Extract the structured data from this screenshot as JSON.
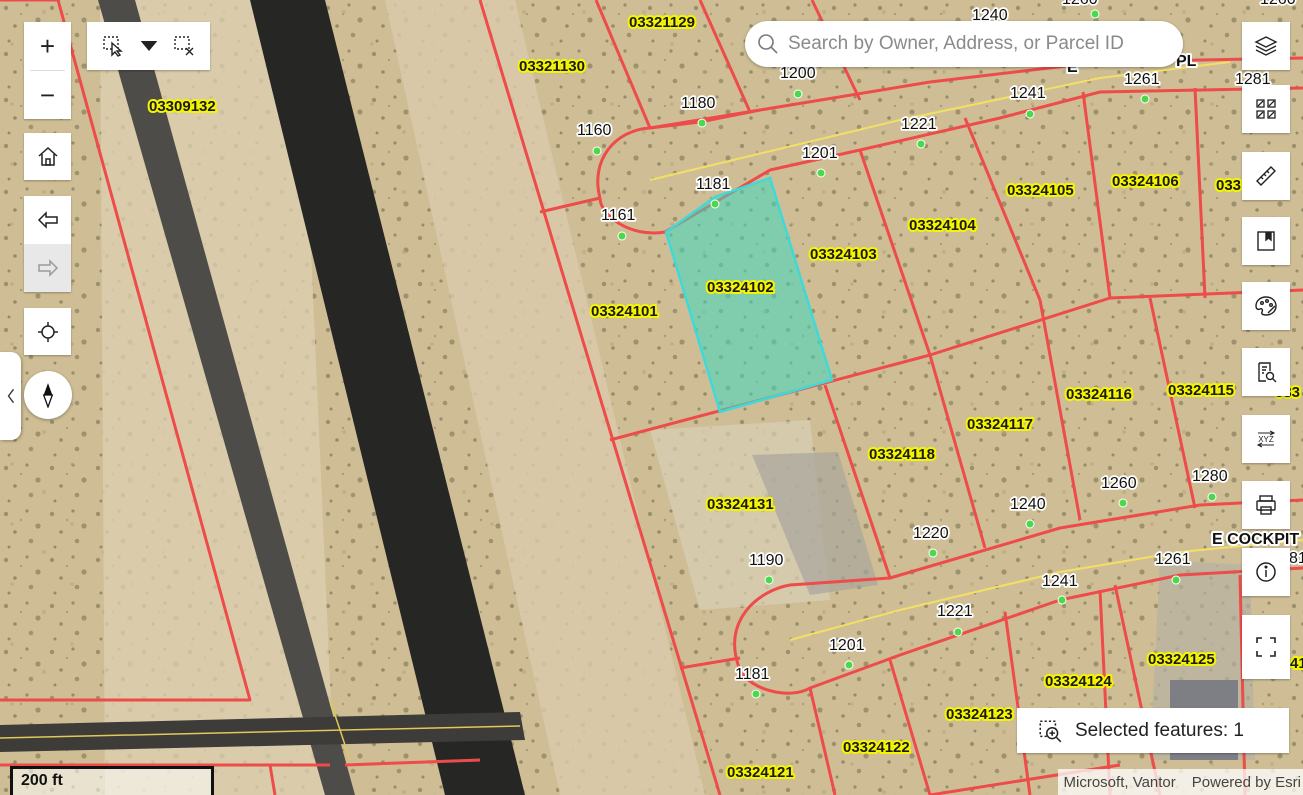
{
  "map": {
    "parcels": [
      {
        "id": "03321129"
      },
      {
        "id": "03321130"
      },
      {
        "id": "03309132"
      },
      {
        "id": "03324105"
      },
      {
        "id": "03324106"
      },
      {
        "id": "03324104"
      },
      {
        "id": "03324103"
      },
      {
        "id": "03324102",
        "selected": true
      },
      {
        "id": "03324101"
      },
      {
        "id": "03324116"
      },
      {
        "id": "03324115"
      },
      {
        "id": "03324117"
      },
      {
        "id": "03324118"
      },
      {
        "id": "03324131"
      },
      {
        "id": "03324125"
      },
      {
        "id": "03324124"
      },
      {
        "id": "03324123"
      },
      {
        "id": "03324122"
      },
      {
        "id": "03324121"
      },
      {
        "id": "033"
      },
      {
        "id": "033"
      },
      {
        "id": "41"
      }
    ],
    "addresses": [
      "1240",
      "1260",
      "1200",
      "1261",
      "1281",
      "1180",
      "1241",
      "1160",
      "1221",
      "1201",
      "1181",
      "1161",
      "1260",
      "1280",
      "1240",
      "1220",
      "1190",
      "1261",
      "1241",
      "1221",
      "1201",
      "1181",
      "81",
      "1260"
    ],
    "streets": [
      "PL",
      "E COCKPIT",
      "E"
    ],
    "colors": {
      "parcel_boundary": "#ee4b4b",
      "selected_fill": "#3fd9c1",
      "selected_outline": "#3fd9d9",
      "parcel_label_halo": "#f5f500",
      "address_point": "#4bd94b",
      "street_centerline": "#f2e066"
    }
  },
  "search": {
    "placeholder": "Search by Owner, Address, or Parcel ID"
  },
  "controls": {
    "zoom_in": "+",
    "zoom_out": "−"
  },
  "selection": {
    "label": "Selected features: 1"
  },
  "scale": {
    "label": "200 ft"
  },
  "attribution": {
    "source": "Microsoft, Vantor",
    "powered": "Powered by Esri"
  }
}
